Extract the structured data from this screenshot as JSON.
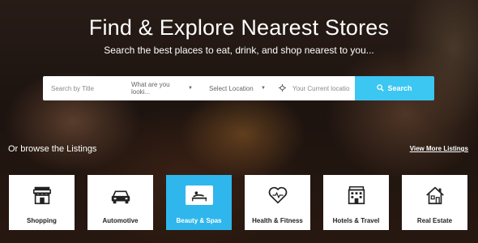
{
  "hero": {
    "title": "Find & Explore Nearest Stores",
    "subtitle": "Search the best places to eat, drink, and shop nearest to you..."
  },
  "search": {
    "title_placeholder": "Search by Title",
    "category_value": "What are you looki...",
    "location_value": "Select Location",
    "current_location_placeholder": "Your Current locatio",
    "button_label": "Search",
    "button_color": "#3cc6f2"
  },
  "browse": {
    "heading": "Or browse the Listings",
    "view_more": "View More Listings"
  },
  "categories": [
    {
      "label": "Shopping",
      "icon": "store-icon",
      "active": false
    },
    {
      "label": "Automotive",
      "icon": "car-icon",
      "active": false
    },
    {
      "label": "Beauty & Spas",
      "icon": "spa-icon",
      "active": true
    },
    {
      "label": "Health & Fitness",
      "icon": "heart-icon",
      "active": false
    },
    {
      "label": "Hotels & Travel",
      "icon": "hotel-icon",
      "active": false
    },
    {
      "label": "Real Estate",
      "icon": "house-icon",
      "active": false
    }
  ],
  "colors": {
    "accent": "#2fb6ec",
    "text_light": "#ffffff"
  }
}
